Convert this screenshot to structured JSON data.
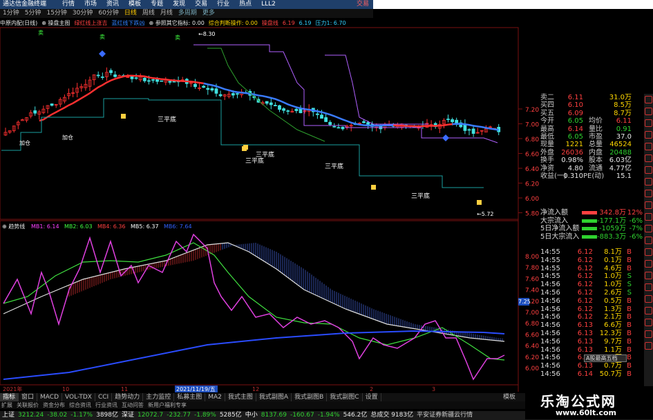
{
  "titlebar": {
    "app_title": "通达信金融终端",
    "menu": [
      "行情",
      "市场",
      "资讯",
      "模板",
      "专题",
      "发现",
      "交易",
      "行业",
      "热点",
      "LLL2"
    ],
    "trade_label": "交易"
  },
  "periods": [
    "1分钟",
    "5分钟",
    "15分钟",
    "30分钟",
    "60分钟",
    "日线",
    "周线",
    "月线",
    "多周期",
    "更多"
  ],
  "period_active_index": 5,
  "indicator_line": [
    {
      "text": "中原内配(日线)",
      "color": "#e8e8e8"
    },
    {
      "text": "⊕ 操盘主图",
      "color": "#e8e8e8"
    },
    {
      "text": "绿红线上涨吉",
      "color": "#ff4040"
    },
    {
      "text": "蓝红线下跌凶",
      "color": "#3080ff"
    },
    {
      "text": "⊕ 参照其它指标: 0.00",
      "color": "#e8e8e8"
    },
    {
      "text": "综合判断操作: 0.00",
      "color": "#ffd700"
    },
    {
      "text": "操盘线",
      "color": "#ff4040"
    },
    {
      "text": "6.19",
      "color": "#ff4040"
    },
    {
      "text": "6.19",
      "color": "#30d0ff"
    },
    {
      "text": "压力1: 6.70",
      "color": "#30d0ff"
    }
  ],
  "main_chart": {
    "price_axis": [
      "7.20",
      "7.00",
      "6.80",
      "6.60",
      "6.40",
      "6.20",
      "6.00",
      "5.80"
    ],
    "annotations": [
      "三平底",
      "三平底",
      "三平底",
      "三平底",
      "三平底",
      "加仓",
      "加仓"
    ],
    "high_label": "8.30",
    "low_label": "5.72",
    "buy_marks": [
      "卖",
      "卖",
      "卖"
    ]
  },
  "sub_chart": {
    "title": "趋势线",
    "legend": [
      {
        "text": "MB1: 6.14",
        "color": "#ff40ff"
      },
      {
        "text": "MB2: 6.03",
        "color": "#40ff40"
      },
      {
        "text": "MB4: 6.36",
        "color": "#ff4040"
      },
      {
        "text": "MB5: 6.37",
        "color": "#ffffff"
      },
      {
        "text": "MB6: 7.64",
        "color": "#3060ff"
      }
    ],
    "axis": [
      "8.00",
      "7.80",
      "7.60",
      "7.40",
      "7.20",
      "7.00",
      "6.80",
      "6.60",
      "6.40",
      "6.20",
      "6.00"
    ],
    "date_labels": [
      "2021年",
      "10",
      "11",
      "2021/11/19/五",
      "12",
      "2",
      "3"
    ],
    "value_tag": "7.25"
  },
  "quote_panel": [
    {
      "l": "卖二",
      "v1": "6.11",
      "c1": "red",
      "l2": "",
      "v2": "31.0万",
      "c2": "yellow"
    },
    {
      "l": "买四",
      "v1": "6.10",
      "c1": "red",
      "l2": "",
      "v2": "8.5万",
      "c2": "yellow"
    },
    {
      "l": "买五",
      "v1": "6.09",
      "c1": "red",
      "l2": "",
      "v2": "8.7万",
      "c2": "yellow"
    },
    {
      "l": "今开",
      "v1": "6.05",
      "c1": "green",
      "l2": "均价",
      "v2": "6.11",
      "c2": "red"
    },
    {
      "l": "最高",
      "v1": "6.14",
      "c1": "red",
      "l2": "量比",
      "v2": "0.91",
      "c2": "green"
    },
    {
      "l": "最低",
      "v1": "6.05",
      "c1": "green",
      "l2": "市盈",
      "v2": "37.0",
      "c2": "white"
    },
    {
      "l": "现量",
      "v1": "1221",
      "c1": "yellow",
      "l2": "总量",
      "v2": "46524",
      "c2": "yellow"
    },
    {
      "l": "外盘",
      "v1": "26036",
      "c1": "red",
      "l2": "内盘",
      "v2": "20488",
      "c2": "green"
    },
    {
      "l": "换手",
      "v1": "0.98%",
      "c1": "white",
      "l2": "股本",
      "v2": "6.03亿",
      "c2": "white"
    },
    {
      "l": "净资",
      "v1": "4.80",
      "c1": "white",
      "l2": "流通",
      "v2": "4.77亿",
      "c2": "white"
    },
    {
      "l": "收益(一)",
      "v1": "0.310",
      "c1": "white",
      "l2": "PE(动)",
      "v2": "15.1",
      "c2": "white"
    }
  ],
  "flow_panel": [
    {
      "l": "净流入额",
      "bar": "#ff4040",
      "v": "342.8万",
      "c": "red",
      "v3": "12%",
      "c3": "red"
    },
    {
      "l": "大宗流入",
      "bar": "#2fd22f",
      "v": "-177.1万",
      "c": "green",
      "v3": "-6%",
      "c3": "green"
    },
    {
      "l": "5日净流入额",
      "bar": "#2fd22f",
      "v": "-1059万",
      "c": "green",
      "v3": "-7%",
      "c3": "green"
    },
    {
      "l": "5日大宗流入",
      "bar": "#2fd22f",
      "v": "-883.3万",
      "c": "green",
      "v3": "-6%",
      "c3": "green"
    }
  ],
  "ticks": [
    {
      "t": "14:55",
      "p": "6.12",
      "v": "8.1万",
      "bs": "B"
    },
    {
      "t": "14:55",
      "p": "6.12",
      "v": "0.1万",
      "bs": "B"
    },
    {
      "t": "14:55",
      "p": "6.12",
      "v": "4.6万",
      "bs": "B"
    },
    {
      "t": "14:55",
      "p": "6.12",
      "v": "1.0万",
      "bs": "S"
    },
    {
      "t": "14:56",
      "p": "6.12",
      "v": "1.0万",
      "bs": "S"
    },
    {
      "t": "14:56",
      "p": "6.12",
      "v": "2.6万",
      "bs": "S"
    },
    {
      "t": "14:56",
      "p": "6.12",
      "v": "0.5万",
      "bs": "B"
    },
    {
      "t": "14:56",
      "p": "6.12",
      "v": "1.3万",
      "bs": "B"
    },
    {
      "t": "14:56",
      "p": "6.12",
      "v": "2.1万",
      "bs": "B"
    },
    {
      "t": "14:56",
      "p": "6.13",
      "v": "6.6万",
      "bs": "B"
    },
    {
      "t": "14:56",
      "p": "6.13",
      "v": "12.3万",
      "bs": "B"
    },
    {
      "t": "14:56",
      "p": "6.13",
      "v": "9.7万",
      "bs": "B"
    },
    {
      "t": "14:56",
      "p": "6.13",
      "v": "1.1万",
      "bs": "B"
    },
    {
      "t": "14:56",
      "p": "6.14",
      "v": "0.8万",
      "bs": "B"
    },
    {
      "t": "14:56",
      "p": "6.13",
      "v": "0.7万",
      "bs": "B"
    },
    {
      "t": "14:56",
      "p": "6.14",
      "v": "50.7万",
      "bs": "B"
    }
  ],
  "bottom_tabs": [
    "指标",
    "窗口",
    "MACD",
    "VOL-TDX",
    "CCI",
    "趋势动力",
    "主力监控",
    "私募主图",
    "MA2",
    "我式主图",
    "我式副图A",
    "我式副图B",
    "我式副图C",
    "设置"
  ],
  "bottom_tab_active": 0,
  "bottom_tail": "模板",
  "sub_tabs": [
    "扩展",
    "关联报价",
    "资金分布",
    "综合资讯",
    "行业资讯",
    "互动问答",
    "新用户福利专享"
  ],
  "status": [
    {
      "label": "上证",
      "v": "3212.24",
      "c": "-38.02",
      "pct": "-1.17%",
      "amt": "3898亿"
    },
    {
      "label": "深证",
      "v": "12072.7",
      "c": "-232.77",
      "pct": "-1.89%",
      "amt": "5285亿"
    },
    {
      "label": "中小",
      "v": "8137.69",
      "c": "-160.67",
      "pct": "-1.94%",
      "amt": "546.2亿"
    }
  ],
  "status_total": "总成交 9183亿",
  "status_news": "平安证券新疆云行情",
  "watermark": {
    "title": "乐淘公式网",
    "url": "www.60lt.com"
  },
  "popup_label": "A股最高五档"
}
